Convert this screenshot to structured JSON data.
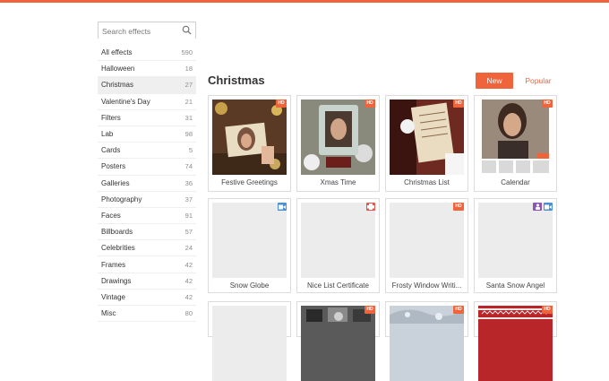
{
  "search": {
    "placeholder": "Search effects"
  },
  "categories": [
    {
      "label": "All effects",
      "count": "590"
    },
    {
      "label": "Halloween",
      "count": "18"
    },
    {
      "label": "Christmas",
      "count": "27"
    },
    {
      "label": "Valentine's Day",
      "count": "21"
    },
    {
      "label": "Filters",
      "count": "31"
    },
    {
      "label": "Lab",
      "count": "98"
    },
    {
      "label": "Cards",
      "count": "5"
    },
    {
      "label": "Posters",
      "count": "74"
    },
    {
      "label": "Galleries",
      "count": "36"
    },
    {
      "label": "Photography",
      "count": "37"
    },
    {
      "label": "Faces",
      "count": "91"
    },
    {
      "label": "Billboards",
      "count": "57"
    },
    {
      "label": "Celebrities",
      "count": "24"
    },
    {
      "label": "Frames",
      "count": "42"
    },
    {
      "label": "Drawings",
      "count": "42"
    },
    {
      "label": "Vintage",
      "count": "42"
    },
    {
      "label": "Misc",
      "count": "80"
    }
  ],
  "main": {
    "title": "Christmas",
    "sort_new": "New",
    "sort_popular": "Popular"
  },
  "effects": [
    {
      "label": "Festive Greetings",
      "badges": [
        "HD"
      ]
    },
    {
      "label": "Xmas Time",
      "badges": [
        "HD"
      ]
    },
    {
      "label": "Christmas List",
      "badges": [
        "HD"
      ]
    },
    {
      "label": "Calendar",
      "badges": [
        "HD"
      ]
    },
    {
      "label": "Snow Globe",
      "badges": [
        "camera"
      ]
    },
    {
      "label": "Nice List Certificate",
      "badges": [
        "print"
      ]
    },
    {
      "label": "Frosty Window Writi...",
      "badges": [
        "HD"
      ]
    },
    {
      "label": "Santa Snow Angel",
      "badges": [
        "person",
        "camera"
      ]
    }
  ],
  "badge_text": {
    "hd": "HD"
  },
  "colors": {
    "accent": "#f0643c",
    "camera_badge": "#4a90d9",
    "print_badge": "#e0584b",
    "person_badge": "#8a55b5"
  },
  "icons": [
    "search-icon",
    "camera-icon",
    "print-icon",
    "person-icon"
  ]
}
